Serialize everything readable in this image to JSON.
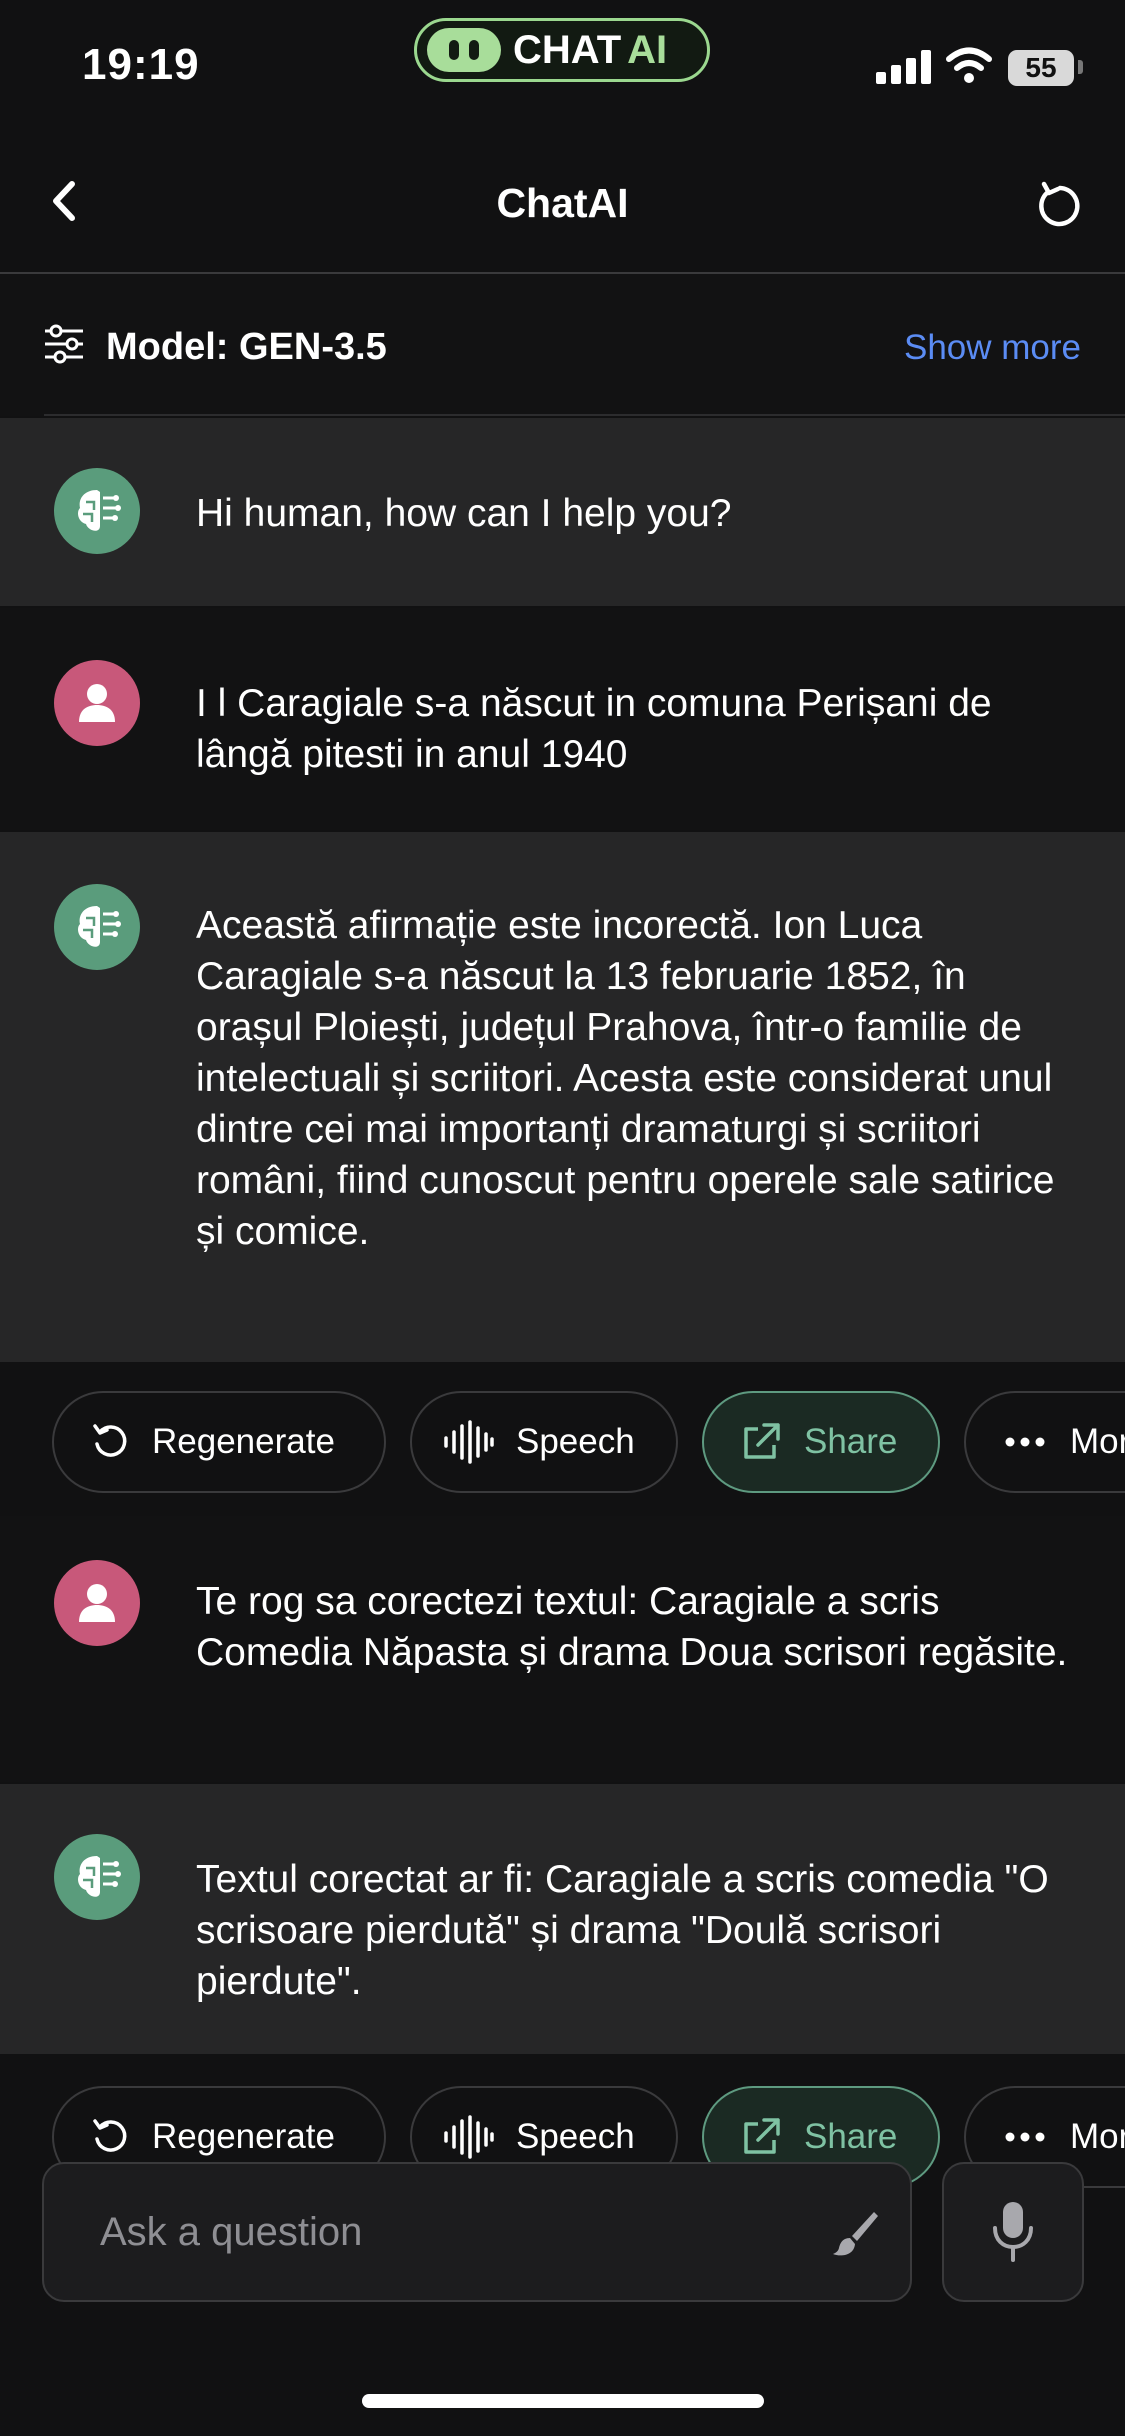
{
  "status_bar": {
    "time": "19:19",
    "app_pill": {
      "text": "CHAT",
      "accent_text": "AI",
      "accent_color": "#a8dd9a"
    },
    "battery": "55"
  },
  "nav": {
    "title": "ChatAI",
    "back_icon": "chevron-left-icon",
    "refresh_icon": "refresh-icon"
  },
  "model_bar": {
    "label": "Model: GEN-3.5",
    "show_more": "Show more",
    "link_color": "#5b8cf4"
  },
  "messages": [
    {
      "role": "assistant",
      "text": "Hi human, how can I help you?"
    },
    {
      "role": "user",
      "text": "I l Caragiale s-a născut in comuna Perișani de lângă pitesti in anul 1940"
    },
    {
      "role": "assistant",
      "text": "Această afirmație este incorectă. Ion Luca Caragiale s-a născut la 13 februarie 1852, în orașul Ploiești, județul Prahova, într-o familie de intelectuali și scriitori. Acesta este considerat unul dintre cei mai importanți dramaturgi și scriitori români, fiind cunoscut pentru operele sale satirice și comice."
    },
    {
      "role": "user",
      "text": "Te rog sa corectezi textul: Caragiale a scris Comedia Năpasta și drama Doua scrisori regăsite."
    },
    {
      "role": "assistant",
      "text": "Textul corectat ar fi: Caragiale a scris comedia \"O scrisoare pierdută\" și drama \"Doulă scrisori pierdute\"."
    }
  ],
  "actions": {
    "regenerate": "Regenerate",
    "speech": "Speech",
    "share": "Share",
    "more": "More"
  },
  "input": {
    "placeholder": "Ask a question"
  },
  "colors": {
    "background": "#111112",
    "ai_bubble": "#262627",
    "ai_avatar": "#5a9c7c",
    "user_avatar": "#c8587a",
    "share_accent": "#7fc2a3"
  }
}
